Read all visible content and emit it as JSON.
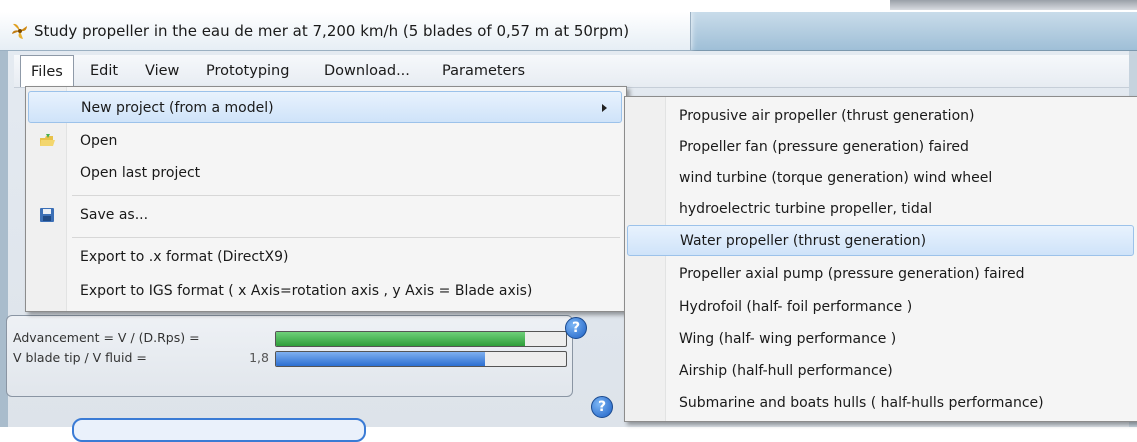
{
  "window": {
    "title": "Study propeller in the eau de mer at 7,200 km/h (5 blades of 0,57 m at 50rpm)"
  },
  "menubar": {
    "items": [
      {
        "label": "Files"
      },
      {
        "label": "Edit"
      },
      {
        "label": "View"
      },
      {
        "label": "Prototyping"
      },
      {
        "label": "Download..."
      },
      {
        "label": "Parameters"
      }
    ],
    "open_item": "Files"
  },
  "files_menu": {
    "items": [
      {
        "label": "New project (from a model)",
        "has_submenu": true,
        "highlighted": true
      },
      {
        "label": "Open",
        "icon": "open-folder-icon"
      },
      {
        "label": "Open last project"
      },
      {
        "label": "Save as...",
        "icon": "floppy-disk-icon"
      },
      {
        "label": "Export to  .x format (DirectX9)"
      },
      {
        "label": "Export to  IGS format ( x Axis=rotation axis ,  y Axis = Blade axis)"
      }
    ]
  },
  "submenu": {
    "items": [
      {
        "label": "Propusive air propeller (thrust generation)"
      },
      {
        "label": "Propeller fan (pressure generation) faired"
      },
      {
        "label": "wind turbine (torque generation) wind wheel"
      },
      {
        "label": "hydroelectric turbine propeller, tidal"
      },
      {
        "label": "Water propeller (thrust generation)",
        "highlighted": true
      },
      {
        "label": "Propeller axial pump (pressure generation) faired"
      },
      {
        "label": "Hydrofoil (half- foil performance )"
      },
      {
        "label": "Wing (half- wing performance )"
      },
      {
        "label": "Airship (half-hull performance)"
      },
      {
        "label": "Submarine and boats  hulls ( half-hulls performance)"
      }
    ]
  },
  "parameters_panel": {
    "advancement_label": "Advancement = V / (D.Rps) =",
    "advancement_fraction": 0.86,
    "advancement_color": "#2e9e3a",
    "blade_tip_label": "V blade tip / V fluid =",
    "blade_tip_value": "1,8",
    "blade_tip_fraction": 0.72,
    "blade_tip_color": "#2c6fd1"
  },
  "colors": {
    "menu_highlight": "#cfe3f9",
    "title_bar": "#9fbfd7"
  }
}
